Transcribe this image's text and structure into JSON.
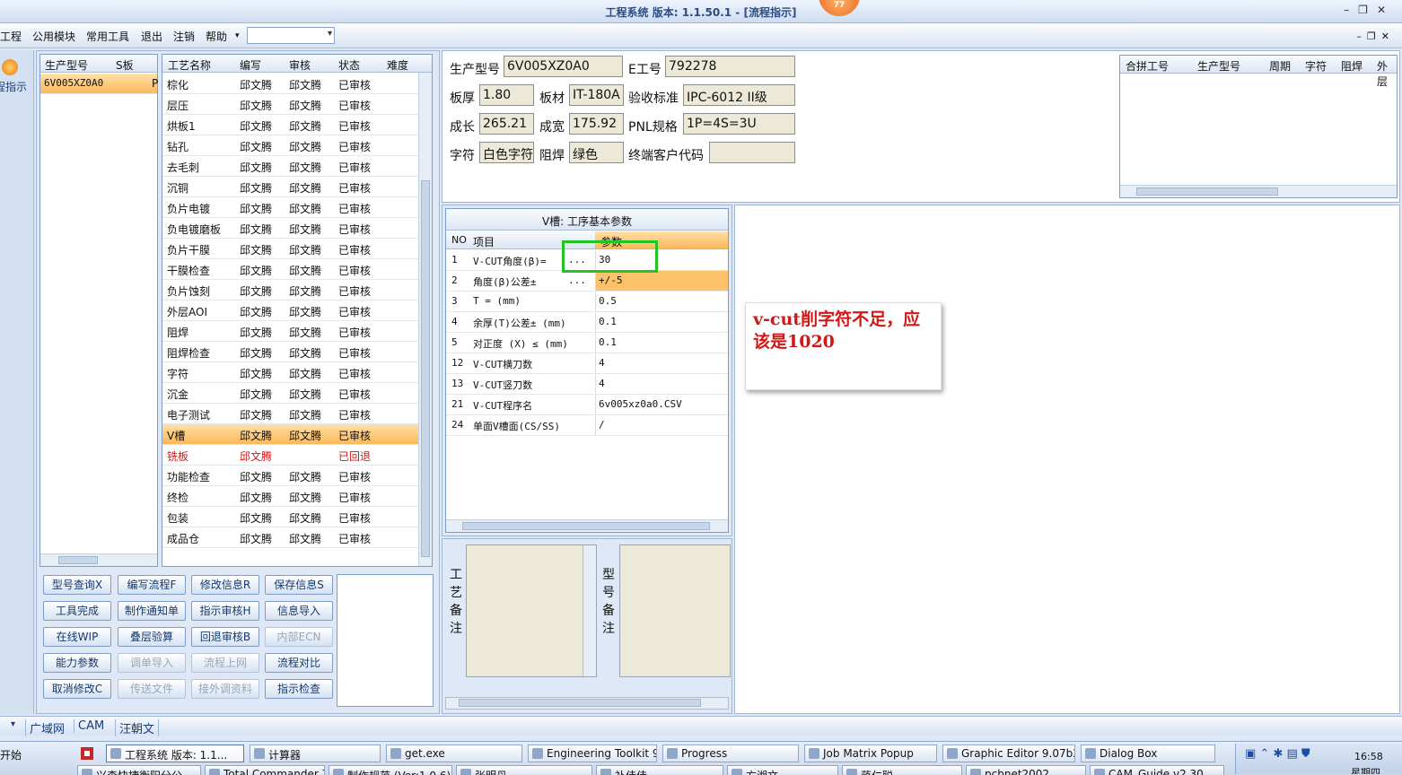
{
  "window": {
    "title": "工程系统  版本: 1.1.50.1 - [流程指示]",
    "badge": "77"
  },
  "menu": [
    "工程",
    "公用模块",
    "常用工具",
    "退出",
    "注销",
    "帮助"
  ],
  "leftstrip": {
    "label": "程指示"
  },
  "model_list": {
    "headers": [
      "生产型号",
      "S板",
      ""
    ],
    "rows": [
      {
        "model": "6V005XZ0A0",
        "flag": "P"
      }
    ]
  },
  "process_list": {
    "headers": [
      "工艺名称",
      "编写",
      "审核",
      "状态",
      "难度"
    ],
    "rows": [
      {
        "name": "棕化",
        "writer": "邱文腾",
        "reviewer": "邱文腾",
        "status": "已审核"
      },
      {
        "name": "层压",
        "writer": "邱文腾",
        "reviewer": "邱文腾",
        "status": "已审核"
      },
      {
        "name": "烘板1",
        "writer": "邱文腾",
        "reviewer": "邱文腾",
        "status": "已审核"
      },
      {
        "name": "钻孔",
        "writer": "邱文腾",
        "reviewer": "邱文腾",
        "status": "已审核"
      },
      {
        "name": "去毛刺",
        "writer": "邱文腾",
        "reviewer": "邱文腾",
        "status": "已审核"
      },
      {
        "name": "沉铜",
        "writer": "邱文腾",
        "reviewer": "邱文腾",
        "status": "已审核"
      },
      {
        "name": "负片电镀",
        "writer": "邱文腾",
        "reviewer": "邱文腾",
        "status": "已审核"
      },
      {
        "name": "负电镀磨板",
        "writer": "邱文腾",
        "reviewer": "邱文腾",
        "status": "已审核"
      },
      {
        "name": "负片干膜",
        "writer": "邱文腾",
        "reviewer": "邱文腾",
        "status": "已审核"
      },
      {
        "name": "干膜检查",
        "writer": "邱文腾",
        "reviewer": "邱文腾",
        "status": "已审核"
      },
      {
        "name": "负片蚀刻",
        "writer": "邱文腾",
        "reviewer": "邱文腾",
        "status": "已审核"
      },
      {
        "name": "外层AOI",
        "writer": "邱文腾",
        "reviewer": "邱文腾",
        "status": "已审核"
      },
      {
        "name": "阻焊",
        "writer": "邱文腾",
        "reviewer": "邱文腾",
        "status": "已审核"
      },
      {
        "name": "阻焊检查",
        "writer": "邱文腾",
        "reviewer": "邱文腾",
        "status": "已审核"
      },
      {
        "name": "字符",
        "writer": "邱文腾",
        "reviewer": "邱文腾",
        "status": "已审核"
      },
      {
        "name": "沉金",
        "writer": "邱文腾",
        "reviewer": "邱文腾",
        "status": "已审核"
      },
      {
        "name": "电子测试",
        "writer": "邱文腾",
        "reviewer": "邱文腾",
        "status": "已审核"
      },
      {
        "name": "V槽",
        "writer": "邱文腾",
        "reviewer": "邱文腾",
        "status": "已审核"
      },
      {
        "name": "铣板",
        "writer": "邱文腾",
        "reviewer": "",
        "status": "已回退"
      },
      {
        "name": "功能检查",
        "writer": "邱文腾",
        "reviewer": "邱文腾",
        "status": "已审核"
      },
      {
        "name": "终检",
        "writer": "邱文腾",
        "reviewer": "邱文腾",
        "status": "已审核"
      },
      {
        "name": "包装",
        "writer": "邱文腾",
        "reviewer": "邱文腾",
        "status": "已审核"
      },
      {
        "name": "成品仓",
        "writer": "邱文腾",
        "reviewer": "邱文腾",
        "status": "已审核"
      }
    ]
  },
  "buttons": [
    [
      "型号查询X",
      "编写流程F",
      "修改信息R",
      "保存信息S"
    ],
    [
      "工具完成",
      "制作通知单",
      "指示审核H",
      "信息导入"
    ],
    [
      "在线WIP",
      "叠层验算",
      "回退审核B",
      "内部ECN"
    ],
    [
      "能力参数",
      "调单导入",
      "流程上网",
      "流程对比"
    ],
    [
      "取消修改C",
      "传送文件",
      "接外调资料",
      "指示检查"
    ]
  ],
  "info": {
    "model_label": "生产型号",
    "model_value": "6V005XZ0A0",
    "e_label": "E工号",
    "e_value": "792278",
    "thick_label": "板厚",
    "thick_value": "1.80",
    "mat_label": "板材",
    "mat_value": "IT-180A",
    "std_label": "验收标准",
    "std_value": "IPC-6012 II级",
    "len_label": "成长",
    "len_value": "265.21",
    "wid_label": "成宽",
    "wid_value": "175.92",
    "pnl_label": "PNL规格",
    "pnl_value": "1P=4S=3U",
    "char_label": "字符",
    "char_value": "白色字符",
    "mask_label": "阻焊",
    "mask_value": "绿色",
    "cust_label": "终端客户代码",
    "cust_value": ""
  },
  "merge_table": {
    "headers": [
      "合拼工号",
      "生产型号",
      "周期",
      "字符",
      "阻焊",
      "外层"
    ]
  },
  "params": {
    "title": "V槽: 工序基本参数",
    "headers": [
      "NO",
      "项目",
      "参数"
    ],
    "rows": [
      {
        "no": "1",
        "item": "V-CUT角度(β)=",
        "dots": "...",
        "value": "30"
      },
      {
        "no": "2",
        "item": "角度(β)公差±",
        "dots": "...",
        "value": "+/-5"
      },
      {
        "no": "3",
        "item": "T =  (mm)",
        "dots": "",
        "value": "0.5"
      },
      {
        "no": "4",
        "item": "余厚(T)公差±  (mm)",
        "dots": "",
        "value": "0.1"
      },
      {
        "no": "5",
        "item": "对正度 (X) ≤ (mm)",
        "dots": "",
        "value": "0.1"
      },
      {
        "no": "12",
        "item": "V-CUT横刀数",
        "dots": "",
        "value": "4"
      },
      {
        "no": "13",
        "item": "V-CUT竖刀数",
        "dots": "",
        "value": "4"
      },
      {
        "no": "21",
        "item": "V-CUT程序名",
        "dots": "",
        "value": "6v005xz0a0.CSV"
      },
      {
        "no": "24",
        "item": "单面V槽面(CS/SS)",
        "dots": "",
        "value": "/"
      }
    ]
  },
  "notes": {
    "process_label": "工艺备注",
    "model_label": "型号备注"
  },
  "annotation": {
    "text": "v-cut削字符不足，应该是1020",
    "color": "#d01818",
    "box_color": "#22c322"
  },
  "status_tabs": [
    "广域网",
    "CAM",
    "汪朝文"
  ],
  "taskbar": {
    "start": "开始",
    "row1": [
      "工程系统  版本: 1.1...",
      "计算器",
      "get.exe",
      "Engineering Toolkit 9.0...",
      "Progress",
      "Job Matrix Popup",
      "Graphic Editor 9.07b2 (...",
      "Dialog Box"
    ],
    "row2": [
      "兴森快捷衡阳分公",
      "Total Commander 7",
      "制作规范 (Ver:1.0.6)",
      "张明丹",
      "补佳佳",
      "方湘文",
      "蒋仁聪",
      "pcbnet2002",
      "CAM_Guide v2.30"
    ],
    "clock": "16:58",
    "weekday": "星期四"
  }
}
